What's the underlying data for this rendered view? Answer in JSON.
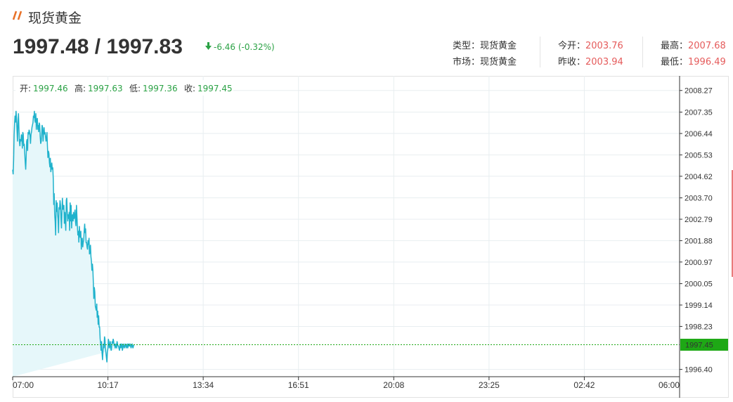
{
  "header": {
    "title": "现货黄金",
    "price": "1997.48 / 1997.83",
    "change": "-6.46 (-0.32%)",
    "icon": "double-slash-icon",
    "accent": "#e8722a"
  },
  "info": {
    "type_label": "类型：",
    "type_value": "现货黄金",
    "market_label": "市场：",
    "market_value": "现货黄金",
    "open_label": "今开：",
    "open_value": "2003.76",
    "prev_label": "昨收：",
    "prev_value": "2003.94",
    "high_label": "最高：",
    "high_value": "2007.68",
    "low_label": "最低：",
    "low_value": "1996.49"
  },
  "ohlc": {
    "open_label": "开:",
    "open_value": "1997.46",
    "high_label": "高:",
    "high_value": "1997.63",
    "low_label": "低:",
    "low_value": "1997.36",
    "close_label": "收:",
    "close_value": "1997.45"
  },
  "chart_data": {
    "type": "area",
    "title": "",
    "xlabel": "",
    "ylabel": "",
    "x_ticks": [
      "07:00",
      "10:17",
      "13:34",
      "16:51",
      "20:08",
      "23:25",
      "02:42",
      "06:00"
    ],
    "y_ticks": [
      "2008.27",
      "2007.35",
      "2006.44",
      "2005.53",
      "2004.62",
      "2003.70",
      "2002.79",
      "2001.88",
      "2000.97",
      "2000.05",
      "1999.14",
      "1998.23",
      "1996.40"
    ],
    "ylim": [
      1996.09,
      2008.89
    ],
    "current_value": "1997.45",
    "line_color": "#20b2cc",
    "fill_color": "#e6f7fa",
    "current_color": "#1ea815",
    "grid": true,
    "series": [
      {
        "x_minutes": [
          0,
          1,
          2,
          3,
          4,
          5,
          6,
          7,
          8,
          9,
          10,
          11,
          12,
          13,
          14,
          15,
          16,
          17,
          18,
          19,
          20,
          21,
          22,
          23,
          24,
          25,
          26,
          27,
          28,
          29,
          30,
          31,
          32,
          33,
          34,
          35,
          36,
          37,
          38,
          39,
          40,
          41,
          42,
          43,
          44,
          45,
          46,
          47,
          48,
          49,
          50,
          51,
          52,
          53,
          54,
          55,
          56,
          57,
          58,
          59,
          60,
          61,
          62,
          63,
          64,
          65,
          66,
          67,
          68,
          69,
          70,
          71,
          72,
          73,
          74,
          75,
          76,
          77,
          78,
          79,
          80,
          81,
          82,
          83,
          84,
          85,
          86,
          87,
          88,
          89,
          90,
          91,
          92,
          93,
          94,
          95,
          96,
          97,
          98,
          99,
          100,
          101,
          102,
          103,
          104,
          105,
          106,
          107,
          108,
          109,
          110,
          111,
          112,
          113,
          114,
          115,
          116,
          117,
          118,
          119,
          120,
          121,
          122,
          123,
          124,
          125,
          126,
          127,
          128,
          129,
          130,
          131,
          132,
          133,
          134,
          135,
          136,
          137,
          138,
          139,
          140,
          141,
          142,
          143,
          144,
          145,
          146,
          147,
          148,
          149,
          150,
          151,
          152,
          153,
          154,
          155,
          156,
          157,
          158,
          159,
          160,
          161,
          162,
          163,
          164,
          165,
          166,
          167,
          168,
          169,
          170,
          171,
          172,
          173,
          174,
          175,
          176,
          177,
          178,
          179,
          180,
          181,
          182,
          183,
          184,
          185,
          186,
          187,
          188,
          189,
          190,
          191,
          192,
          193,
          194,
          195,
          196,
          197,
          198,
          199,
          200,
          201,
          202,
          203,
          204,
          205,
          206,
          207,
          208,
          209,
          210,
          211,
          212,
          213,
          214,
          215,
          216,
          217,
          218,
          219,
          220,
          221,
          222,
          223,
          224,
          225,
          226,
          227,
          228,
          229,
          230,
          231,
          232,
          233,
          234,
          235,
          236,
          237,
          238,
          239,
          240,
          241,
          242,
          243,
          244,
          245,
          246,
          247,
          248,
          249,
          250,
          251,
          252,
          253,
          254,
          255,
          256
        ],
        "values": [
          2004.9,
          2004.7,
          2005.3,
          2006.4,
          2006.9,
          2007.2,
          2006.9,
          2007.4,
          2007.1,
          2006.6,
          2006.1,
          2006.9,
          2007.3,
          2006.7,
          2006.1,
          2005.9,
          2006.2,
          2006.1,
          2006.4,
          2006.3,
          2005.8,
          2006.5,
          2006.4,
          2005.9,
          2006.0,
          2005.6,
          2005.2,
          2004.9,
          2005.5,
          2006.1,
          2006.2,
          2005.7,
          2006.5,
          2006.4,
          2006.6,
          2006.5,
          2006.3,
          2006.0,
          2006.4,
          2006.5,
          2006.7,
          2006.8,
          2006.9,
          2007.2,
          2007.1,
          2007.4,
          2007.0,
          2006.9,
          2007.3,
          2006.6,
          2007.0,
          2007.1,
          2006.6,
          2006.8,
          2006.5,
          2006.9,
          2006.8,
          2006.3,
          2006.0,
          2006.1,
          2006.4,
          2006.8,
          2006.7,
          2006.1,
          2006.5,
          2006.7,
          2006.4,
          2006.5,
          2006.3,
          2006.1,
          2006.2,
          2006.5,
          2005.9,
          2005.4,
          2005.7,
          2005.6,
          2005.2,
          2005.0,
          2005.4,
          2004.8,
          2005.0,
          2005.2,
          2004.9,
          2005.0,
          2004.5,
          2003.4,
          2003.9,
          2003.0,
          2002.7,
          2002.1,
          2003.6,
          2003.1,
          2003.5,
          2003.0,
          2002.8,
          2002.2,
          2003.3,
          2003.2,
          2003.6,
          2003.4,
          2002.8,
          2002.4,
          2003.1,
          2003.7,
          2003.2,
          2003.3,
          2003.4,
          2002.6,
          2003.1,
          2002.7,
          2002.3,
          2003.6,
          2003.7,
          2003.1,
          2002.7,
          2003.0,
          2002.8,
          2003.1,
          2002.3,
          2003.5,
          2002.7,
          2003.4,
          2002.4,
          2002.9,
          2003.0,
          2002.7,
          2003.1,
          2002.8,
          2002.9,
          2003.2,
          2002.7,
          2002.5,
          2003.4,
          2002.9,
          2002.5,
          2002.1,
          2002.3,
          2001.8,
          2002.5,
          2002.1,
          2002.0,
          2002.3,
          2001.5,
          2001.9,
          2002.0,
          2001.6,
          2001.8,
          2001.9,
          2002.3,
          2002.6,
          2002.2,
          2002.4,
          2001.8,
          2001.8,
          2001.6,
          2001.5,
          2001.9,
          2001.7,
          2002.0,
          2001.3,
          2001.4,
          2001.7,
          2001.2,
          2001.0,
          2000.6,
          2000.9,
          2000.6,
          2000.1,
          1999.4,
          1999.9,
          1999.7,
          1999.1,
          1999.0,
          1998.9,
          1999.2,
          1998.6,
          1998.9,
          1998.3,
          1998.7,
          1998.2,
          1998.2,
          1997.7,
          1997.5,
          1997.2,
          1997.6,
          1997.1,
          1996.8,
          1997.2,
          1997.5,
          1997.3,
          1997.8,
          1997.7,
          1997.3,
          1997.1,
          1996.9,
          1996.7,
          1997.2,
          1997.3,
          1997.7,
          1997.6,
          1997.3,
          1997.4,
          1997.6,
          1997.3,
          1997.2,
          1997.4,
          1997.6,
          1997.5,
          1997.7,
          1997.6,
          1997.4,
          1997.5,
          1997.3,
          1997.4,
          1997.5,
          1997.3,
          1997.6,
          1997.5,
          1997.4,
          1997.4,
          1997.3,
          1997.2,
          1997.4,
          1997.5,
          1997.3,
          1997.4,
          1997.5,
          1997.2,
          1997.3,
          1997.5,
          1997.4,
          1997.3,
          1997.4,
          1997.5,
          1997.4,
          1997.3,
          1997.4,
          1997.5,
          1997.3,
          1997.4,
          1997.5,
          1997.4,
          1997.4,
          1997.5,
          1997.4,
          1997.3,
          1997.4,
          1997.5,
          1997.4,
          1997.3,
          1997.4,
          1997.45
        ]
      }
    ]
  }
}
